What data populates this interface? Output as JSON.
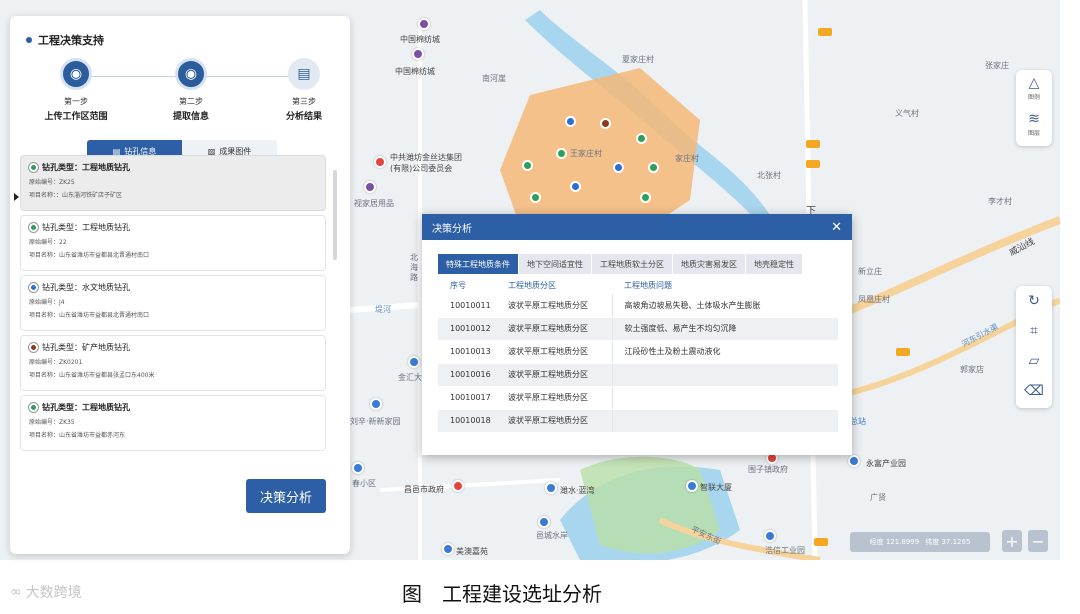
{
  "panel": {
    "title": "工程决策支持",
    "steps": [
      {
        "step": "第一步",
        "label": "上传工作区范围",
        "state": "done"
      },
      {
        "step": "第二步",
        "label": "提取信息",
        "state": "done"
      },
      {
        "step": "第三步",
        "label": "分析结果",
        "state": "pending"
      }
    ],
    "tabs": [
      {
        "label": "钻孔信息",
        "icon": "list-icon",
        "active": true
      },
      {
        "label": "成果图件",
        "icon": "image-icon",
        "active": false
      }
    ],
    "cards": [
      {
        "type": "钻孔类型：工程地质钻孔",
        "dot": "#2f9e5a",
        "bold": true,
        "line1": "原始编号：ZK25",
        "line2": "项目名称：：山东淄河铁矿店子矿区",
        "selected": true
      },
      {
        "type": "钻孔类型：工程地质钻孔",
        "dot": "#2f9e5a",
        "bold": false,
        "line1": "原始编号：22",
        "line2": "项目名称：山东省潍坊市益都县北晋通村南口",
        "selected": false
      },
      {
        "type": "钻孔类型：水文地质钻孔",
        "dot": "#2c6fd1",
        "bold": false,
        "line1": "原始编号：J4",
        "line2": "项目名称：山东省潍坊市益都县北晋通村南口",
        "selected": false
      },
      {
        "type": "钻孔类型：矿产地质钻孔",
        "dot": "#8b3a1e",
        "bold": false,
        "line1": "原始编号：ZK0201",
        "line2": "项目名称：山东省潍坊市益都县张孟口东400米",
        "selected": false
      },
      {
        "type": "钻孔类型：工程地质钻孔",
        "dot": "#2f9e5a",
        "bold": true,
        "line1": "原始编号：ZK35",
        "line2": "项目名称：山东省潍坊市益都赤河东",
        "selected": false
      }
    ],
    "decide_label": "决策分析"
  },
  "modal": {
    "title": "决策分析",
    "close": "✕",
    "tabs": [
      "特殊工程地质条件",
      "地下空间适宜性",
      "工程地质软土分区",
      "地质灾害易发区",
      "地壳稳定性"
    ],
    "columns": [
      "序号",
      "工程地质分区",
      "工程地质问题"
    ],
    "rows": [
      [
        "10010011",
        "波状平原工程地质分区",
        "高坡角边坡易失稳、土体吸水产生膨胀"
      ],
      [
        "10010012",
        "波状平原工程地质分区",
        "软土强度低、易产生不均匀沉降"
      ],
      [
        "10010013",
        "波状平原工程地质分区",
        "江段砂性土及粉土震动液化"
      ],
      [
        "10010016",
        "波状平原工程地质分区",
        ""
      ],
      [
        "10010017",
        "波状平原工程地质分区",
        ""
      ],
      [
        "10010018",
        "波状平原工程地质分区",
        ""
      ]
    ]
  },
  "map": {
    "labels": [
      "中国棉纺城",
      "中国棉纺城",
      "南河崖",
      "夏家庄村",
      "张家庄",
      "义气村",
      "王家庄村",
      "家庄村",
      "北张村",
      "李才村",
      "中共潍坊金丝达集团",
      "(有限)公司委员会",
      "视家居用品",
      "北",
      "海",
      "路",
      "新立庄",
      "凤凰庄村",
      "郭家店",
      "堤河",
      "金汇大",
      "刘辛·新新家园",
      "总站",
      "春小区",
      "昌邑市政府",
      "潍水·蓝湾",
      "智联大厦",
      "围子镇政府",
      "永富产业园",
      "广贤",
      "邑城水岸",
      "美澳嘉苑",
      "平安东街",
      "浩信工业园",
      "威汕线",
      "河东引水渠",
      "下"
    ],
    "toolbar_top": [
      {
        "icon": "shape-icon",
        "label": "图例"
      },
      {
        "icon": "layers-icon",
        "label": "图层"
      }
    ],
    "toolbar_tools": [
      "reset-icon",
      "crop-icon",
      "polygon-icon",
      "eraser-icon"
    ],
    "coords": {
      "lng_label": "经度 121.8999",
      "lat_label": "纬度 37.1265"
    },
    "zoom_in": "+",
    "zoom_out": "−"
  },
  "footer": {
    "watermark": "大数跨境",
    "caption": "图　工程建设选址分析"
  }
}
